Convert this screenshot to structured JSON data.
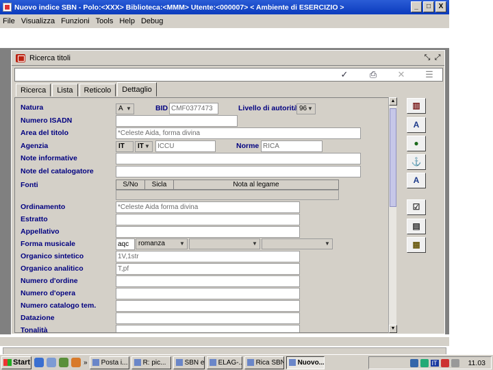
{
  "window": {
    "title": "Nuovo indice SBN - Polo:<XXX> Biblioteca:<MMM> Utente:<000007>    < Ambiente di ESERCIZIO >",
    "minimize": "_",
    "maximize": "□",
    "close": "X"
  },
  "menu": [
    "File",
    "Visualizza",
    "Funzioni",
    "Tools",
    "Help",
    "Debug"
  ],
  "inner_window": {
    "title": "Ricerca titoli"
  },
  "tabs": [
    "Ricerca",
    "Lista",
    "Reticolo",
    "Dettaglio"
  ],
  "active_tab": "Dettaglio",
  "form": {
    "natura_label": "Natura",
    "natura_value": "A",
    "bid_label": "BID",
    "bid_value": "CMF0377473",
    "livello_label": "Livello di autorità",
    "livello_value": "96",
    "numero_isadn_label": "Numero ISADN",
    "area_titolo_label": "Area del titolo",
    "area_titolo_value": "*Celeste Aida, forma divina",
    "agenzia_label": "Agenzia",
    "agenzia_value1": "IT",
    "agenzia_value2": "IT",
    "agenzia_code": "ICCU",
    "norme_label": "Norme",
    "norme_value": "RICA",
    "note_informative_label": "Note informative",
    "note_catalogatore_label": "Note del catalogatore",
    "fonti_label": "Fonti",
    "fonti_columns": [
      "S/No",
      "Sicla",
      "Nota al legame"
    ],
    "ordinamento_label": "Ordinamento",
    "ordinamento_value": "*Celeste Aida forma divina",
    "estratto_label": "Estratto",
    "appellativo_label": "Appellativo",
    "forma_musicale_label": "Forma musicale",
    "forma_code": "aqc",
    "forma_value": "romanza",
    "organico_sintetico_label": "Organico sintetico",
    "organico_sintetico_value": "1V,1str",
    "organico_analitico_label": "Organico analitico",
    "organico_analitico_value": "T,pf",
    "numero_ordine_label": "Numero d'ordine",
    "numero_opera_label": "Numero d'opera",
    "numero_catalogo_label": "Numero catalogo tem.",
    "datazione_label": "Datazione",
    "tonalita_label": "Tonalità"
  },
  "taskbar": {
    "start": "Start",
    "tasks": [
      "Posta i...",
      "R: pic...",
      "SBN e ...",
      "ELAG-...",
      "Rica SBN",
      "Nuovo..."
    ],
    "lang": "IT",
    "clock": "11.03"
  },
  "colors": {
    "title_blue": "#0b3bbd",
    "label_navy": "#000080",
    "face": "#d4d0c8"
  }
}
